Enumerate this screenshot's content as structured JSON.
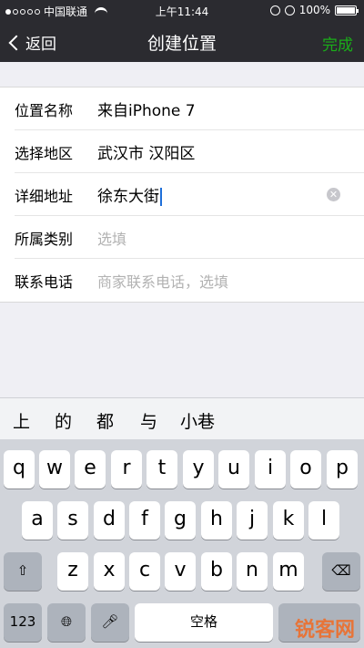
{
  "status_bar": {
    "carrier": "中国联通",
    "time": "上午11:44",
    "battery": "100%",
    "battery_level": 1.0
  },
  "nav": {
    "back_label": "返回",
    "title": "创建位置",
    "done_label": "完成",
    "done_color": "#1aad19"
  },
  "form": {
    "rows": [
      {
        "label": "位置名称",
        "value": "来自iPhone 7"
      },
      {
        "label": "选择地区",
        "value": "武汉市 汉阳区"
      },
      {
        "label": "详细地址",
        "value": "徐东大街"
      },
      {
        "label": "所属类别",
        "placeholder": "选填"
      },
      {
        "label": "联系电话",
        "placeholder": "商家联系电话，选填"
      }
    ]
  },
  "suggestions": [
    "上",
    "的",
    "都",
    "与",
    "小巷"
  ],
  "keyboard": {
    "row1": [
      "q",
      "w",
      "e",
      "r",
      "t",
      "y",
      "u",
      "i",
      "o",
      "p"
    ],
    "row2": [
      "a",
      "s",
      "d",
      "f",
      "g",
      "h",
      "j",
      "k",
      "l"
    ],
    "row3": [
      "z",
      "x",
      "c",
      "v",
      "b",
      "n",
      "m"
    ],
    "numbers_label": "123",
    "space_label": "空格",
    "shift_icon": "shift-icon",
    "delete_icon": "delete-icon",
    "globe_icon": "globe-icon",
    "mic_icon": "microphone-icon"
  },
  "watermark": "锐客网"
}
